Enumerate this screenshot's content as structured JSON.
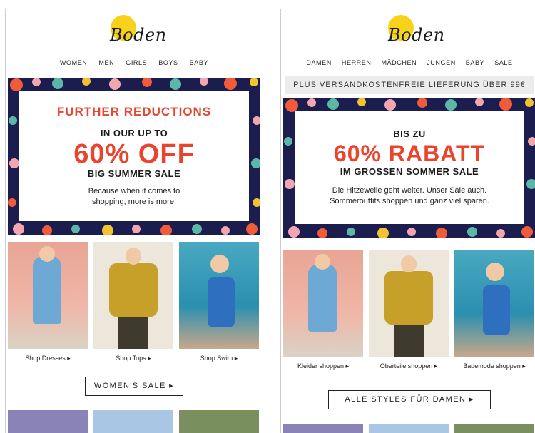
{
  "brand": {
    "logo_text": "Boden",
    "logo_color": "#f6d21b"
  },
  "colors": {
    "accent_red": "#e8452c",
    "navy": "#1b1d4e",
    "border": "#c9ccd6"
  },
  "en": {
    "nav": [
      "WOMEN",
      "MEN",
      "GIRLS",
      "BOYS",
      "BABY"
    ],
    "hero": {
      "line1": "FURTHER REDUCTIONS",
      "line2": "IN OUR UP TO",
      "big": "60% OFF",
      "line3": "BIG SUMMER SALE",
      "copy1": "Because when it comes to",
      "copy2": "shopping, more is more."
    },
    "products": [
      {
        "caption": "Shop Dresses ▸"
      },
      {
        "caption": "Shop Tops ▸"
      },
      {
        "caption": "Shop Swim ▸"
      }
    ],
    "cta": "WOMEN'S SALE ▸"
  },
  "de": {
    "nav": [
      "DAMEN",
      "HERREN",
      "MÄDCHEN",
      "JUNGEN",
      "BABY",
      "SALE"
    ],
    "shipping": "PLUS VERSANDKOSTENFREIE LIEFERUNG ÜBER 99€",
    "hero": {
      "line2": "BIS ZU",
      "big": "60% RABATT",
      "line3": "IM GROSSEN SOMMER SALE",
      "copy1": "Die Hitzewelle geht weiter. Unser Sale auch.",
      "copy2": "Sommeroutfits shoppen und ganz viel sparen."
    },
    "products": [
      {
        "caption": "Kleider shoppen ▸"
      },
      {
        "caption": "Oberteile shoppen ▸"
      },
      {
        "caption": "Bademode shoppen ▸"
      }
    ],
    "cta": "ALLE STYLES FÜR DAMEN ▸"
  }
}
